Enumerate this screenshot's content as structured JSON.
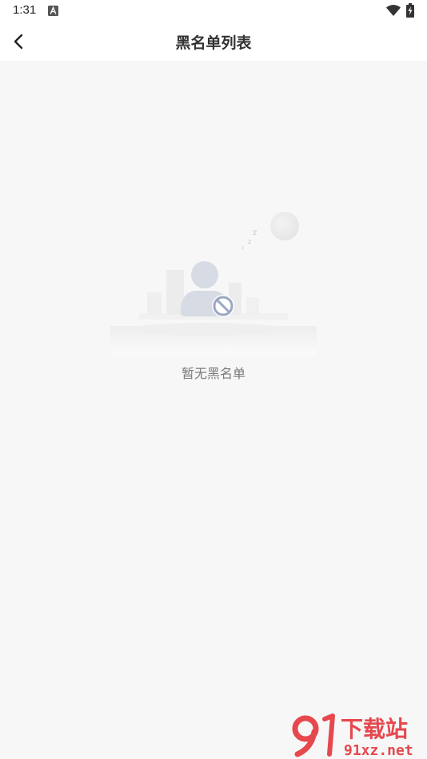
{
  "status_bar": {
    "time": "1:31",
    "icons": [
      "a-notification-icon",
      "wifi-icon",
      "battery-charging-icon"
    ]
  },
  "nav": {
    "back_icon": "chevron-left-icon",
    "title": "黑名单列表"
  },
  "empty_state": {
    "illustration": "blocked-user-icon",
    "message": "暂无黑名单"
  },
  "watermark": {
    "brand": "91下载站",
    "domain": "91xz.net"
  },
  "colors": {
    "background": "#f7f7f7",
    "header": "#ffffff",
    "watermark_red": "#e5484d",
    "user_icon": "#d6dbe4",
    "block_badge": "#9aa7c4"
  }
}
